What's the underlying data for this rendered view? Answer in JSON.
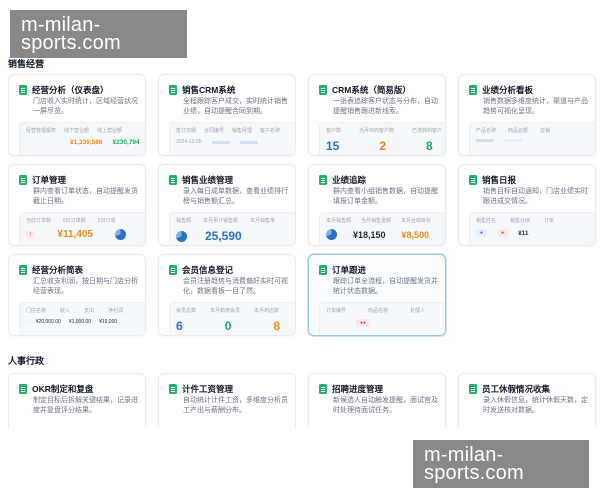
{
  "watermark": "m-milan-sports.com",
  "sections": [
    {
      "title": "销售经营"
    },
    {
      "title": "人事行政"
    }
  ],
  "cards": [
    {
      "title": "经营分析（仪表盘）",
      "desc": "门店收入实时统计，区域经营状况一屏尽览。",
      "preview": {
        "heads": [
          "经营管理报表",
          "线下营业额",
          "线上营业额"
        ],
        "vals": [
          "",
          "¥1,339,586",
          "¥230,794"
        ]
      }
    },
    {
      "title": "销售CRM系统",
      "desc": "全程跟踪客户成交，实时统计销售业绩，自动提醒合同到期。",
      "preview": {
        "heads": [
          "签订日期",
          "合同编号",
          "销售经理",
          "客户名称"
        ],
        "vals": [
          "2024-12-05",
          "",
          "",
          ""
        ]
      }
    },
    {
      "title": "CRM系统（简易版）",
      "desc": "一张表追踪客户状态与分布，自动提醒销售跟进新线索。",
      "preview": {
        "heads": [
          "客户数",
          "当月中的客户数",
          "已流转的客户"
        ],
        "vals": [
          "15",
          "2",
          "8"
        ]
      }
    },
    {
      "title": "业绩分析看板",
      "desc": "销售数据多维度统计，渠道与产品趋势可视化呈现。",
      "preview": {
        "heads": [
          "产品名称",
          "商品总额",
          "总销"
        ],
        "vals": []
      }
    },
    {
      "title": "订单管理",
      "desc": "群内查看订单状态，自动提醒发货截止日期。",
      "preview": {
        "heads": [
          "当前订单数",
          "5日订单额",
          "5日订单"
        ],
        "vals": [
          "",
          "¥11,405",
          ""
        ]
      }
    },
    {
      "title": "销售业绩管理",
      "desc": "录入每日成单数据，查看业绩排行榜与销售额汇总。",
      "preview": {
        "heads": [
          "销售额",
          "本月累计销售额",
          "本月销售单"
        ],
        "vals": [
          "",
          "25,590",
          ""
        ]
      }
    },
    {
      "title": "业绩追踪",
      "desc": "群内查看小组销售数据，自动提醒填报订单金额。",
      "preview": {
        "heads": [
          "本月销售额",
          "当月销售金额",
          "本月业绩目标"
        ],
        "vals": [
          "",
          "¥18,150",
          "¥8,500"
        ]
      }
    },
    {
      "title": "销售日报",
      "desc": "销售目标自动通知，门店业绩实时跟进成交情况。",
      "preview": {
        "heads": [
          "销售姓名",
          "销售业绩",
          "订单"
        ],
        "vals": [
          "¥11"
        ]
      }
    },
    {
      "title": "经营分析简表",
      "desc": "汇总收支利润，按日期与门店分析经营表现。",
      "preview": {
        "heads": [
          "门店名称",
          "收入",
          "支出",
          "净利润"
        ],
        "vals": [
          "¥20,000.00",
          "¥1,000.00",
          "¥19,000"
        ]
      }
    },
    {
      "title": "会员信息登记",
      "desc": "会员注册趋势与消费偏好实时可视化，数据看板一目了然。",
      "preview": {
        "heads": [
          "会员总数",
          "本月新增会员",
          "本月到店数"
        ],
        "vals": [
          "6",
          "0",
          "8"
        ]
      }
    },
    {
      "title": "订单跟进",
      "desc": "跟踪订单全流程，自动提醒发货并统计状态数据。",
      "preview": {
        "heads": [
          "订单编号",
          "商品名称",
          "处理人"
        ],
        "vals": []
      }
    },
    {
      "title": "OKR制定和复盘",
      "desc": "制定目标后拆解关键结果，记录进度并复盘评分结果。",
      "preview": {
        "heads": [],
        "vals": []
      }
    },
    {
      "title": "计件工资管理",
      "desc": "自动统计计件工资，多维度分析员工产出与薪酬分布。",
      "preview": {
        "heads": [],
        "vals": []
      }
    },
    {
      "title": "招聘进度管理",
      "desc": "新候选人自动触发提醒，面试官及时处理待面试任务。",
      "preview": {
        "heads": [],
        "vals": []
      }
    },
    {
      "title": "员工休假情况收集",
      "desc": "录入休假信息，统计休假天数，定时发送核对数据。",
      "preview": {
        "heads": [],
        "vals": []
      }
    }
  ]
}
